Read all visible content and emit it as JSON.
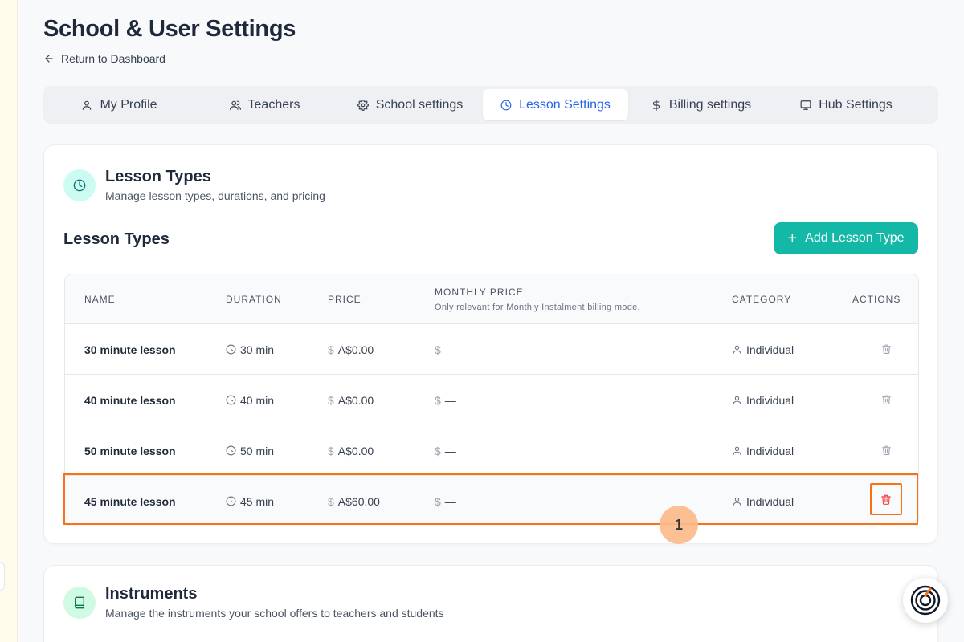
{
  "page": {
    "title": "School & User Settings",
    "back_link": "Return to Dashboard"
  },
  "tabs": [
    {
      "label": "My Profile",
      "icon": "user-icon",
      "active": false
    },
    {
      "label": "Teachers",
      "icon": "users-icon",
      "active": false
    },
    {
      "label": "School settings",
      "icon": "gear-icon",
      "active": false
    },
    {
      "label": "Lesson Settings",
      "icon": "clock-icon",
      "active": true
    },
    {
      "label": "Billing settings",
      "icon": "dollar-icon",
      "active": false
    },
    {
      "label": "Hub Settings",
      "icon": "monitor-icon",
      "active": false
    }
  ],
  "lesson_card": {
    "title": "Lesson Types",
    "subtitle": "Manage lesson types, durations, and pricing",
    "section_title": "Lesson Types",
    "add_button": "Add Lesson Type",
    "columns": {
      "name": "NAME",
      "duration": "DURATION",
      "price": "PRICE",
      "monthly_price": "MONTHLY PRICE",
      "monthly_note": "Only relevant for Monthly Instalment billing mode.",
      "category": "CATEGORY",
      "actions": "ACTIONS"
    },
    "rows": [
      {
        "name": "30 minute lesson",
        "duration": "30 min",
        "price": "A$0.00",
        "monthly": "—",
        "category": "Individual"
      },
      {
        "name": "40 minute lesson",
        "duration": "40 min",
        "price": "A$0.00",
        "monthly": "—",
        "category": "Individual"
      },
      {
        "name": "50 minute lesson",
        "duration": "50 min",
        "price": "A$0.00",
        "monthly": "—",
        "category": "Individual"
      },
      {
        "name": "45 minute lesson",
        "duration": "45 min",
        "price": "A$60.00",
        "monthly": "—",
        "category": "Individual"
      }
    ],
    "dollar_glyph": "$"
  },
  "instruments_card": {
    "title": "Instruments",
    "subtitle": "Manage the instruments your school offers to teachers and students"
  },
  "annotation": {
    "marker_label": "1"
  },
  "colors": {
    "accent": "#2563eb",
    "teal": "#14b8a6",
    "highlight": "#f97316",
    "danger": "#ef4444"
  }
}
